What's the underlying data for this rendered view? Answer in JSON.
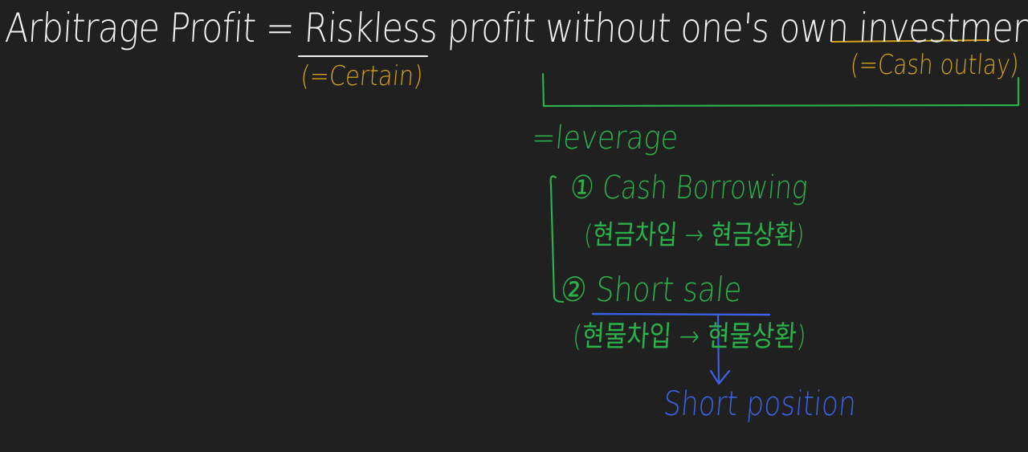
{
  "board": {
    "title_line": "Arbitrage Profit = Riskless profit without one's own investment",
    "notes": {
      "certain": "(=Certain)",
      "cash_outlay": "(=Cash outlay)"
    },
    "leverage": {
      "label": "=leverage",
      "item_1": "① Cash Borrowing",
      "item_1_korean": "(현금차입 → 현금상환)",
      "item_2": "② Short sale",
      "item_2_korean": "(현물차입 → 현물상환)"
    },
    "short_position": "Short position"
  },
  "colors": {
    "background": "#202020",
    "white_ink": "#f2f2f2",
    "gold_ink": "#d4a21a",
    "green_ink": "#2bb14a",
    "blue_ink": "#3b62e6"
  }
}
